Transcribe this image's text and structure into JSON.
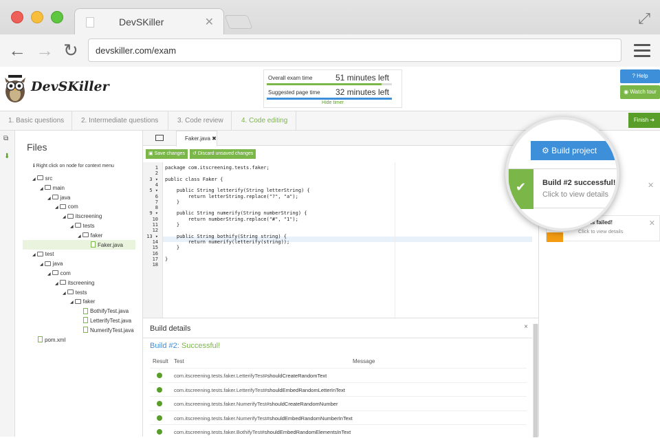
{
  "browser": {
    "tab_title": "DevSKiller",
    "tab_close": "✕",
    "url": "devskiller.com/exam",
    "back": "←",
    "forward": "→",
    "reload": "↻",
    "expand": "⤢"
  },
  "header": {
    "logo_text": "DevSKiller",
    "timer": {
      "overall_label": "Overall exam time",
      "overall_value": "51 minutes left",
      "overall_progress": 0.92,
      "page_label": "Suggested page time",
      "page_value": "32 minutes left",
      "page_progress": 1.0,
      "hide_label": "Hide timer"
    },
    "help_label": "? Help",
    "tour_label": "Watch tour",
    "colors": {
      "green": "#7ab648",
      "blue": "#3c8fd8",
      "orange": "#f39c12"
    }
  },
  "steps": {
    "items": [
      {
        "label": "1. Basic questions",
        "state": "done"
      },
      {
        "label": "2. Intermediate questions",
        "state": "done"
      },
      {
        "label": "3. Code review",
        "state": "done"
      },
      {
        "label": "4. Code editing",
        "state": "active"
      }
    ],
    "finish_label": "Finish ➜"
  },
  "files": {
    "title": "Files",
    "info": "Right click on node for context menu",
    "tree": [
      {
        "name": "src",
        "type": "folder"
      },
      {
        "name": "main",
        "type": "folder"
      },
      {
        "name": "java",
        "type": "folder"
      },
      {
        "name": "com",
        "type": "folder"
      },
      {
        "name": "itscreening",
        "type": "folder"
      },
      {
        "name": "tests",
        "type": "folder"
      },
      {
        "name": "faker",
        "type": "folder"
      },
      {
        "name": "Faker.java",
        "type": "file",
        "selected": true
      },
      {
        "name": "test",
        "type": "folder"
      },
      {
        "name": "java",
        "type": "folder"
      },
      {
        "name": "com",
        "type": "folder"
      },
      {
        "name": "itscreening",
        "type": "folder"
      },
      {
        "name": "tests",
        "type": "folder"
      },
      {
        "name": "faker",
        "type": "folder"
      },
      {
        "name": "BothifyTest.java",
        "type": "file"
      },
      {
        "name": "LetterifyTest.java",
        "type": "file"
      },
      {
        "name": "NumerifyTest.java",
        "type": "file"
      },
      {
        "name": "pom.xml",
        "type": "file"
      }
    ]
  },
  "editor": {
    "tab_label": "Faker.java ✖",
    "save_label": "Save changes",
    "discard_label": "Discard unsaved changes",
    "lines": [
      "package com.itscreening.tests.faker;",
      "",
      "public class Faker {",
      "",
      "    public String letterify(String letterString) {",
      "        return letterString.replace(\"?\", \"a\");",
      "    }",
      "",
      "    public String numerify(String numberString) {",
      "        return numberString.replace(\"#\", \"1\");",
      "    }",
      "",
      "    public String bothify(String string) {",
      "        return numerify(letterify(string));",
      "    }",
      "",
      "}",
      ""
    ]
  },
  "build": {
    "title": "Build details",
    "close": "×",
    "status_prefix": "Build #2: ",
    "status_value": "Successful!",
    "columns": [
      "Result",
      "Test",
      "Message"
    ],
    "rows": [
      {
        "class": "com.itscreening.tests.faker.LetterifyTest#",
        "method": "shouldCreateRandomText"
      },
      {
        "class": "com.itscreening.tests.faker.LetterifyTest#",
        "method": "shouldEmbedRandomLetterInText"
      },
      {
        "class": "com.itscreening.tests.faker.NumerifyTest#",
        "method": "shouldCreateRandomNumber"
      },
      {
        "class": "com.itscreening.tests.faker.NumerifyTest#",
        "method": "shouldEmbedRandomNumberInText"
      },
      {
        "class": "com.itscreening.tests.faker.BothifyTest#",
        "method": "shouldEmbedRandomElementsInText"
      }
    ]
  },
  "notifications": {
    "build_button": "Build project",
    "success_title": "Build #2 successful!",
    "success_sub": "Click to view details",
    "failed_title": "Tests failed!",
    "failed_sub": "Click to view details",
    "close": "✕"
  }
}
